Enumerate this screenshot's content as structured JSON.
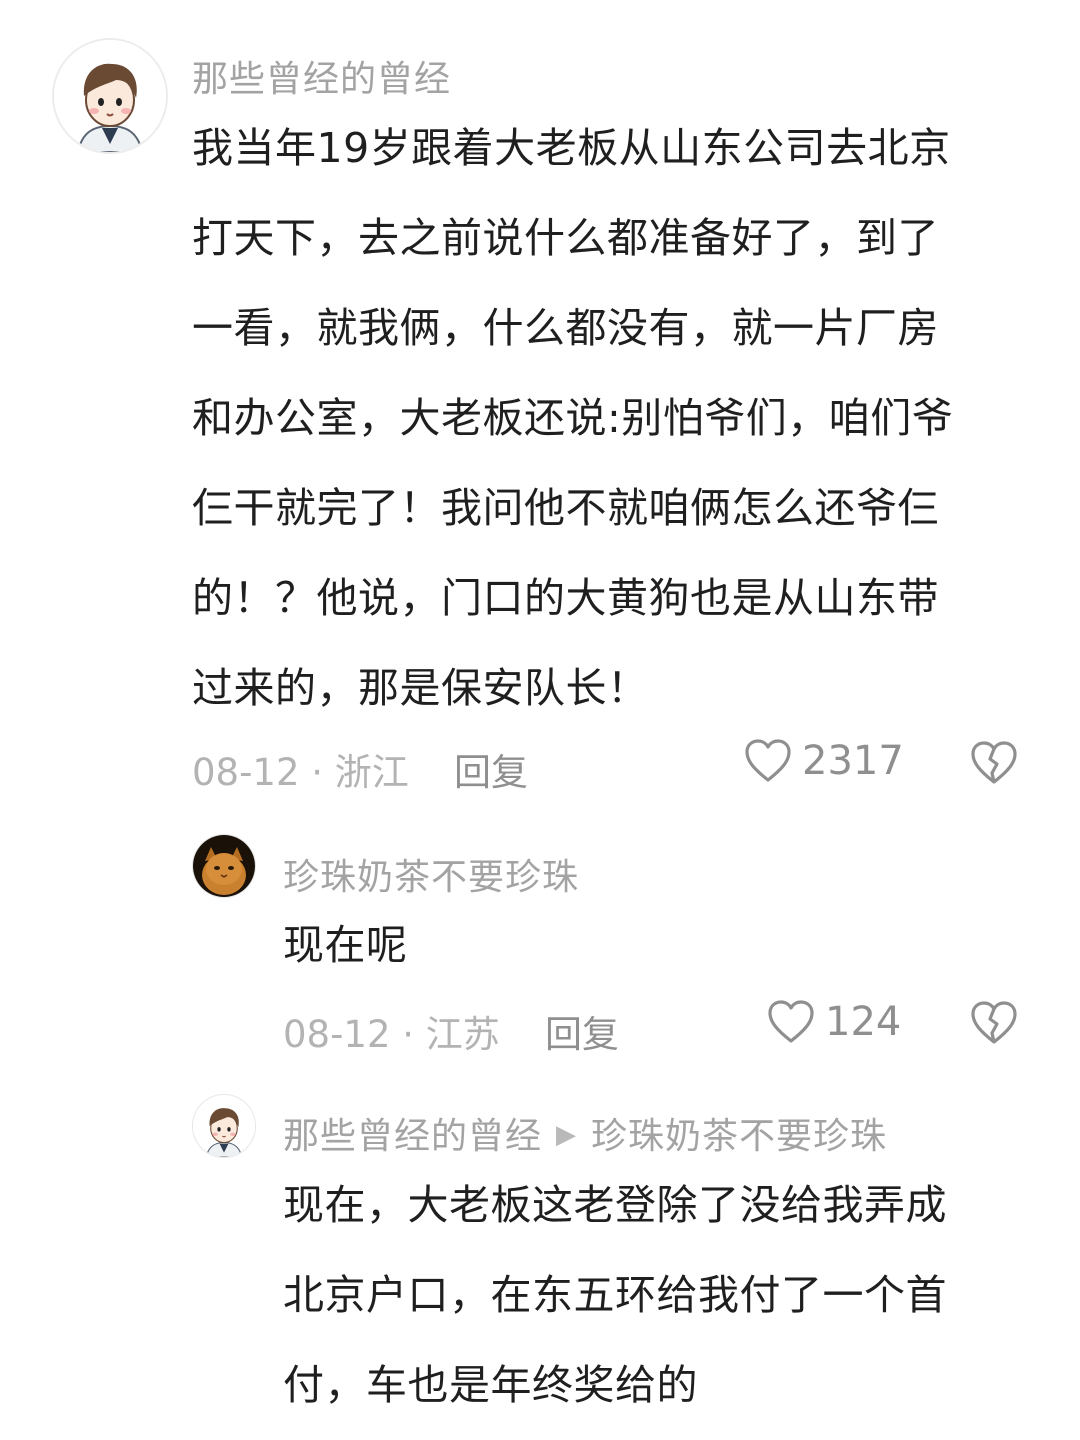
{
  "comment": {
    "author": "那些曾经的曾经",
    "lines": [
      "我当年19岁跟着大老板从山东公司去北京",
      "打天下，去之前说什么都准备好了，到了",
      "一看，就我俩，什么都没有，就一片厂房",
      "和办公室，大老板还说:别怕爷们，咱们爷",
      "仨干就完了！我问他不就咱俩怎么还爷仨",
      "的！？他说，门口的大黄狗也是从山东带",
      "过来的，那是保安队长！"
    ],
    "meta": "08-12 · 浙江",
    "reply_label": "回复",
    "likes": "2317"
  },
  "replies": [
    {
      "author": "珍珠奶茶不要珍珠",
      "text": "现在呢",
      "meta": "08-12 · 江苏",
      "reply_label": "回复",
      "likes": "124"
    },
    {
      "author": "那些曾经的曾经",
      "reply_to": "珍珠奶茶不要珍珠",
      "lines": [
        "现在，大老板这老登除了没给我弄成",
        "北京户口，在东五环给我付了一个首",
        "付，车也是年终奖给的"
      ]
    }
  ],
  "icons": {
    "like": "heart-outline-icon",
    "dislike": "broken-heart-icon",
    "arrow": "triangle-right-icon"
  },
  "colors": {
    "username": "#a3a3a3",
    "text": "#1f1f1f",
    "meta": "#b3b3b3",
    "icon": "#8f8f8f"
  }
}
